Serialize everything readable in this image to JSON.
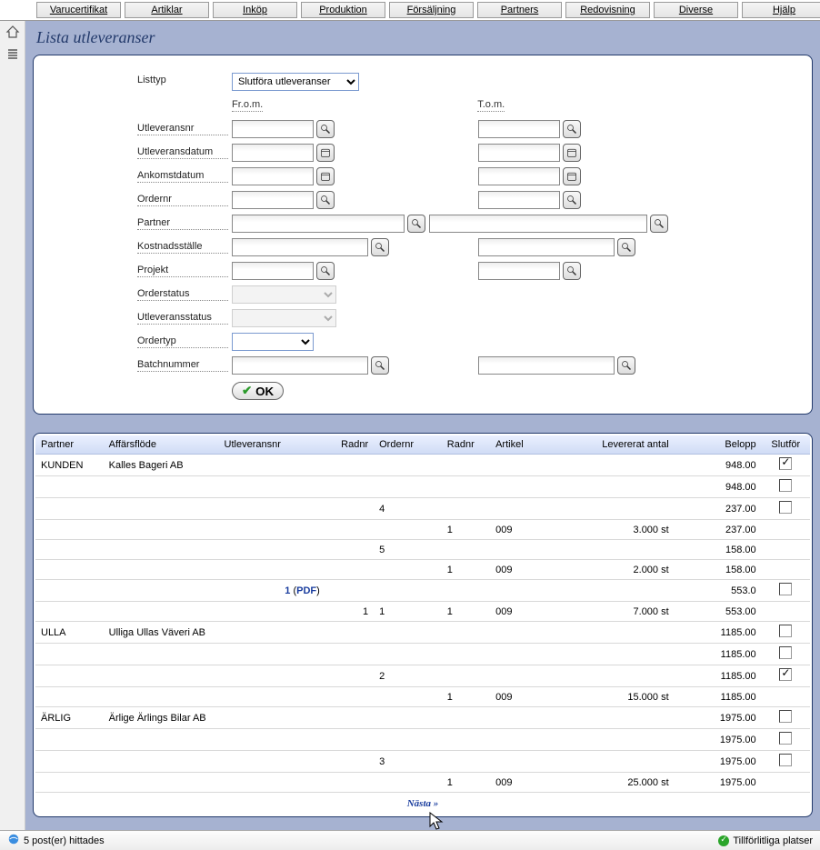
{
  "nav": [
    "Varucertifikat",
    "Artiklar",
    "Inköp",
    "Produktion",
    "Försäljning",
    "Partners",
    "Redovisning",
    "Diverse",
    "Hjälp"
  ],
  "page_title": "Lista utleveranser",
  "form": {
    "listtyp_label": "Listtyp",
    "listtyp_value": "Slutföra utleveranser",
    "from_label": "Fr.o.m.",
    "to_label": "T.o.m.",
    "utleveransnr_label": "Utleveransnr",
    "utleveransdatum_label": "Utleveransdatum",
    "ankomstdatum_label": "Ankomstdatum",
    "ordernr_label": "Ordernr",
    "partner_label": "Partner",
    "kostnadsstalle_label": "Kostnadsställe",
    "projekt_label": "Projekt",
    "orderstatus_label": "Orderstatus",
    "utleveransstatus_label": "Utleveransstatus",
    "ordertyp_label": "Ordertyp",
    "batchnummer_label": "Batchnummer",
    "ok_label": "OK"
  },
  "grid": {
    "headers": {
      "partner": "Partner",
      "affarsflode": "Affärsflöde",
      "utleveransnr": "Utleveransnr",
      "radnr1": "Radnr",
      "ordernr": "Ordernr",
      "radnr2": "Radnr",
      "artikel": "Artikel",
      "levererat": "Levererat antal",
      "belopp": "Belopp",
      "slutfor": "Slutför"
    },
    "rows": [
      {
        "partner": "KUNDEN",
        "affarsflode": "Kalles Bageri AB",
        "utleveransnr": "",
        "radnr1": "",
        "ordernr": "",
        "radnr2": "",
        "artikel": "",
        "levererat": "",
        "belopp": "948.00",
        "slutfor": true
      },
      {
        "partner": "",
        "affarsflode": "",
        "utleveransnr": "",
        "radnr1": "",
        "ordernr": "",
        "radnr2": "",
        "artikel": "",
        "levererat": "",
        "belopp": "948.00",
        "slutfor": false,
        "chk": true
      },
      {
        "partner": "",
        "affarsflode": "",
        "utleveransnr": "",
        "radnr1": "",
        "ordernr": "4",
        "radnr2": "",
        "artikel": "",
        "levererat": "",
        "belopp": "237.00",
        "slutfor": false,
        "chk": true
      },
      {
        "partner": "",
        "affarsflode": "",
        "utleveransnr": "",
        "radnr1": "",
        "ordernr": "",
        "radnr2": "1",
        "artikel": "009",
        "levererat": "3.000 st",
        "belopp": "237.00",
        "slutfor": null
      },
      {
        "partner": "",
        "affarsflode": "",
        "utleveransnr": "",
        "radnr1": "",
        "ordernr": "5",
        "radnr2": "",
        "artikel": "",
        "levererat": "",
        "belopp": "158.00",
        "slutfor": null
      },
      {
        "partner": "",
        "affarsflode": "",
        "utleveransnr": "",
        "radnr1": "",
        "ordernr": "",
        "radnr2": "1",
        "artikel": "009",
        "levererat": "2.000 st",
        "belopp": "158.00",
        "slutfor": null
      },
      {
        "partner": "",
        "affarsflode": "",
        "utleveransnr_link": "1",
        "pdf": "PDF",
        "radnr1": "",
        "ordernr": "",
        "radnr2": "",
        "artikel": "",
        "levererat": "",
        "belopp": "553.0",
        "slutfor": false,
        "chk": true
      },
      {
        "partner": "",
        "affarsflode": "",
        "utleveransnr": "",
        "radnr1": "1",
        "ordernr": "1",
        "radnr2": "1",
        "artikel": "009",
        "levererat": "7.000 st",
        "belopp": "553.00",
        "slutfor": null
      },
      {
        "partner": "ULLA",
        "affarsflode": "Ulliga Ullas Väveri AB",
        "utleveransnr": "",
        "radnr1": "",
        "ordernr": "",
        "radnr2": "",
        "artikel": "",
        "levererat": "",
        "belopp": "1185.00",
        "slutfor": false,
        "chk": true
      },
      {
        "partner": "",
        "affarsflode": "",
        "utleveransnr": "",
        "radnr1": "",
        "ordernr": "",
        "radnr2": "",
        "artikel": "",
        "levererat": "",
        "belopp": "1185.00",
        "slutfor": false,
        "chk": true
      },
      {
        "partner": "",
        "affarsflode": "",
        "utleveransnr": "",
        "radnr1": "",
        "ordernr": "2",
        "radnr2": "",
        "artikel": "",
        "levererat": "",
        "belopp": "1185.00",
        "slutfor": true
      },
      {
        "partner": "",
        "affarsflode": "",
        "utleveransnr": "",
        "radnr1": "",
        "ordernr": "",
        "radnr2": "1",
        "artikel": "009",
        "levererat": "15.000 st",
        "belopp": "1185.00",
        "slutfor": null
      },
      {
        "partner": "ÄRLIG",
        "affarsflode": "Ärlige Ärlings Bilar AB",
        "utleveransnr": "",
        "radnr1": "",
        "ordernr": "",
        "radnr2": "",
        "artikel": "",
        "levererat": "",
        "belopp": "1975.00",
        "slutfor": false,
        "chk": true
      },
      {
        "partner": "",
        "affarsflode": "",
        "utleveransnr": "",
        "radnr1": "",
        "ordernr": "",
        "radnr2": "",
        "artikel": "",
        "levererat": "",
        "belopp": "1975.00",
        "slutfor": false,
        "chk": true
      },
      {
        "partner": "",
        "affarsflode": "",
        "utleveransnr": "",
        "radnr1": "",
        "ordernr": "3",
        "radnr2": "",
        "artikel": "",
        "levererat": "",
        "belopp": "1975.00",
        "slutfor": false,
        "chk": true
      },
      {
        "partner": "",
        "affarsflode": "",
        "utleveransnr": "",
        "radnr1": "",
        "ordernr": "",
        "radnr2": "1",
        "artikel": "009",
        "levererat": "25.000 st",
        "belopp": "1975.00",
        "slutfor": null
      }
    ],
    "pager_next": "Nästa »"
  },
  "status": {
    "left": "5 post(er) hittades",
    "right": "Tillförlitliga platser"
  }
}
